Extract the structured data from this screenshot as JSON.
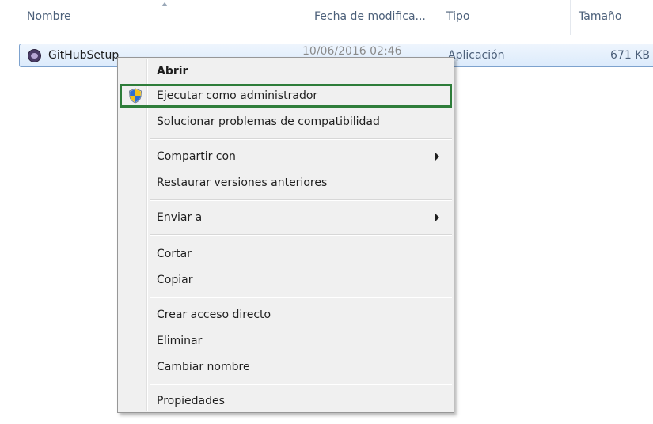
{
  "columns": {
    "name": "Nombre",
    "date": "Fecha de modifica...",
    "type": "Tipo",
    "size": "Tamaño"
  },
  "file": {
    "name": "GitHubSetup",
    "date": "10/06/2016 02:46",
    "type": "Aplicación",
    "size": "671 KB",
    "icon": "github-setup-icon"
  },
  "context_menu": {
    "items": [
      {
        "label": "Abrir"
      },
      {
        "label": "Ejecutar como administrador",
        "icon": "uac-shield-icon",
        "highlight_color": "#2e7d3a"
      },
      {
        "label": "Solucionar problemas de compatibilidad"
      },
      {
        "label": "Compartir con"
      },
      {
        "label": "Restaurar versiones anteriores"
      },
      {
        "label": "Enviar a"
      },
      {
        "label": "Cortar"
      },
      {
        "label": "Copiar"
      },
      {
        "label": "Crear acceso directo"
      },
      {
        "label": "Eliminar"
      },
      {
        "label": "Cambiar nombre"
      },
      {
        "label": "Propiedades"
      }
    ]
  }
}
